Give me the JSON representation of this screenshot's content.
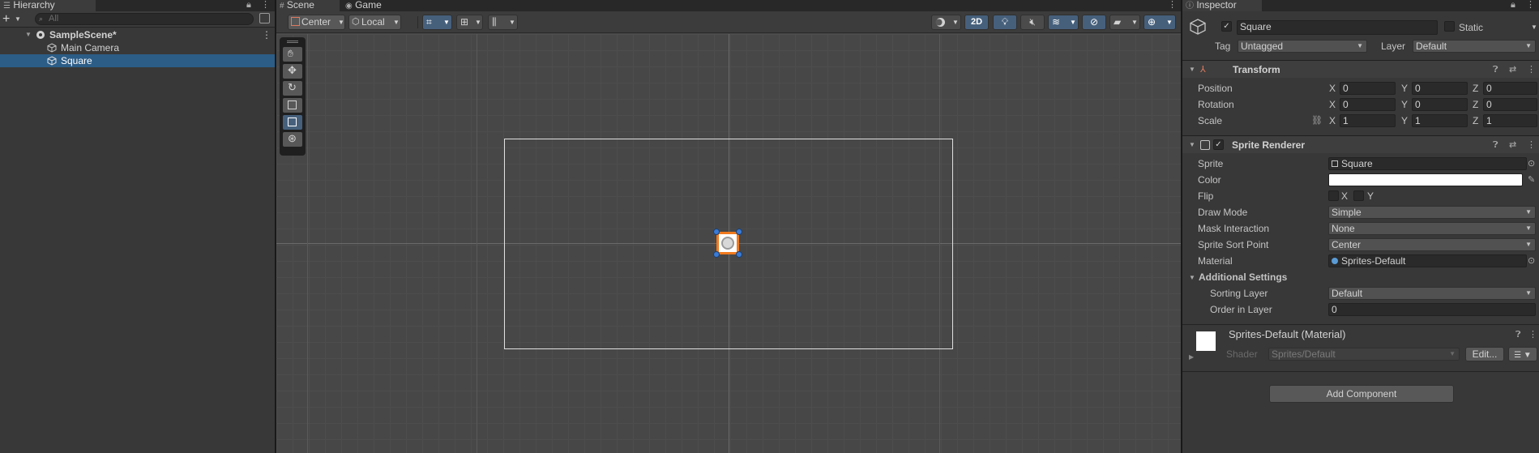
{
  "hierarchy": {
    "tab": "Hierarchy",
    "search_placeholder": "All",
    "items": [
      {
        "label": "SampleScene*"
      },
      {
        "label": "Main Camera"
      },
      {
        "label": "Square"
      }
    ]
  },
  "scene_view": {
    "tabs": [
      {
        "label": "Scene"
      },
      {
        "label": "Game"
      }
    ],
    "pivot_label": "Center",
    "space_label": "Local",
    "mode_2d_label": "2D"
  },
  "inspector": {
    "tab": "Inspector",
    "object_name": "Square",
    "static_label": "Static",
    "tag_label": "Tag",
    "tag_value": "Untagged",
    "layer_label": "Layer",
    "layer_value": "Default",
    "transform": {
      "title": "Transform",
      "position_label": "Position",
      "rotation_label": "Rotation",
      "scale_label": "Scale",
      "position": {
        "x": "0",
        "y": "0",
        "z": "0"
      },
      "rotation": {
        "x": "0",
        "y": "0",
        "z": "0"
      },
      "scale": {
        "x": "1",
        "y": "1",
        "z": "1"
      },
      "axis_x": "X",
      "axis_y": "Y",
      "axis_z": "Z"
    },
    "sprite_renderer": {
      "title": "Sprite Renderer",
      "sprite_label": "Sprite",
      "sprite_value": "Square",
      "color_label": "Color",
      "color_value": "#ffffff",
      "flip_label": "Flip",
      "flip_x": "X",
      "flip_y": "Y",
      "draw_mode_label": "Draw Mode",
      "draw_mode_value": "Simple",
      "mask_label": "Mask Interaction",
      "mask_value": "None",
      "sort_point_label": "Sprite Sort Point",
      "sort_point_value": "Center",
      "material_label": "Material",
      "material_value": "Sprites-Default",
      "additional_label": "Additional Settings",
      "sorting_layer_label": "Sorting Layer",
      "sorting_layer_value": "Default",
      "order_label": "Order in Layer",
      "order_value": "0"
    },
    "material": {
      "title": "Sprites-Default (Material)",
      "shader_label": "Shader",
      "shader_value": "Sprites/Default",
      "edit_label": "Edit..."
    },
    "add_component_label": "Add Component"
  },
  "colors": {
    "selection": "#2c5d87",
    "accent_orange": "#f07a1e",
    "handle_blue": "#3a7bd5"
  }
}
